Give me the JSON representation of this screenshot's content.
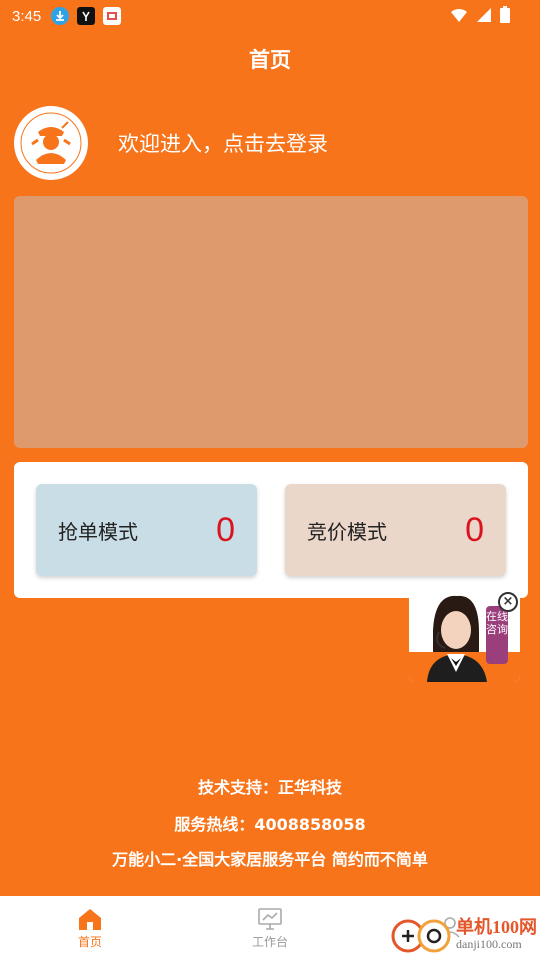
{
  "status_bar": {
    "time": "3:45",
    "icons": [
      "download-icon",
      "app-icon",
      "app-icon",
      "wifi-icon",
      "signal-icon",
      "battery-icon"
    ]
  },
  "header": {
    "title": "首页"
  },
  "profile": {
    "welcome": "欢迎进入，点击去登录"
  },
  "modes": {
    "grab": {
      "label": "抢单模式",
      "count": "0"
    },
    "bid": {
      "label": "竞价模式",
      "count": "0"
    }
  },
  "consult": {
    "label": "在线咨询"
  },
  "footer": {
    "support": "技术支持：正华科技",
    "hotline": "服务热线：4008858058",
    "slogan": "万能小二·全国大家居服务平台 简约而不简单"
  },
  "tabs": [
    {
      "label": "首页",
      "active": true
    },
    {
      "label": "工作台",
      "active": false
    },
    {
      "label": "",
      "active": false
    }
  ],
  "watermark": {
    "name": "单机100网",
    "url": "danji100.com"
  },
  "colors": {
    "brand": "#F7741A",
    "banner": "#DE996D",
    "count": "#D9141E"
  }
}
